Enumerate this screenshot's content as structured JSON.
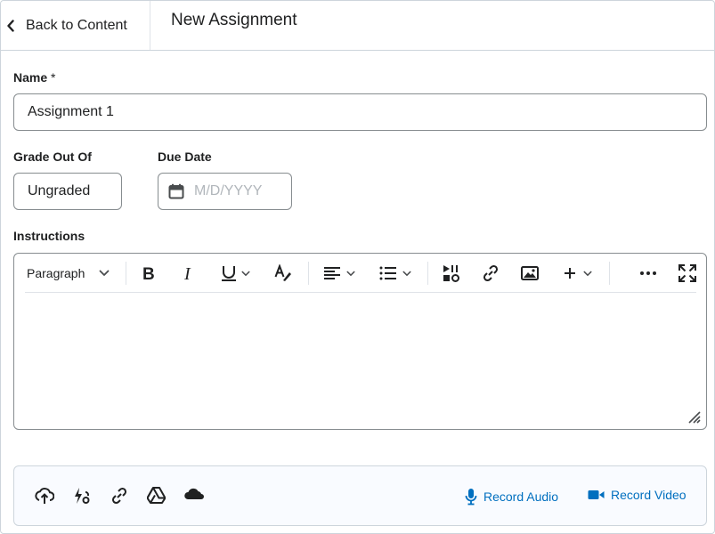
{
  "header": {
    "back_label": "Back to Content",
    "title": "New Assignment"
  },
  "form": {
    "name_label": "Name",
    "required_mark": "*",
    "name_value": "Assignment 1",
    "grade_label": "Grade Out Of",
    "grade_value": "Ungraded",
    "due_label": "Due Date",
    "due_placeholder": "M/D/YYYY",
    "instructions_label": "Instructions"
  },
  "editor": {
    "format_value": "Paragraph",
    "toolbar_icons": [
      "bold-icon",
      "italic-icon",
      "underline-icon",
      "text-color-icon",
      "align-icon",
      "list-icon",
      "insert-stuff-icon",
      "link-icon",
      "image-icon",
      "plus-icon",
      "more-icon",
      "fullscreen-icon"
    ]
  },
  "attachments": {
    "icons": [
      "upload-icon",
      "quicklink-icon",
      "weblink-icon",
      "google-drive-icon",
      "onedrive-icon"
    ],
    "record_audio_label": "Record Audio",
    "record_video_label": "Record Video"
  },
  "colors": {
    "accent": "#006fbf",
    "border": "#868c8f",
    "placeholder": "#b1b6bb"
  }
}
